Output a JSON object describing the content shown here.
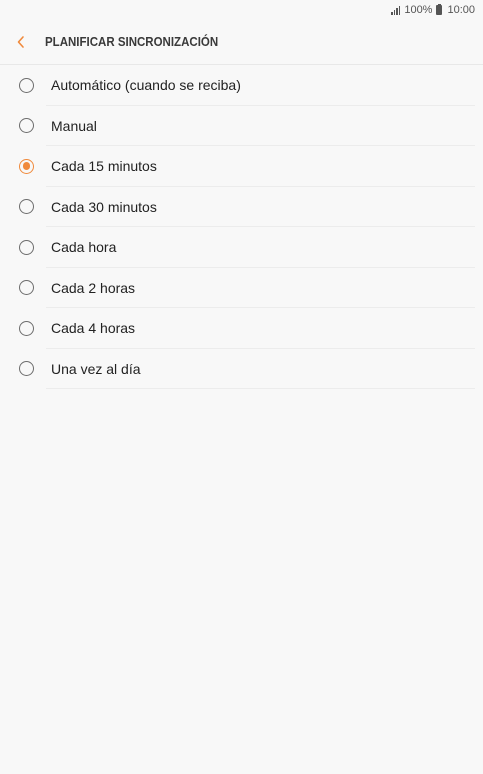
{
  "status_bar": {
    "battery": "100%",
    "time": "10:00"
  },
  "header": {
    "title": "PLANIFICAR SINCRONIZACIÓN",
    "back_icon": "chevron-left-icon"
  },
  "colors": {
    "accent": "#f08a3c",
    "background": "#f8f8f8"
  },
  "options": [
    {
      "label": "Automático (cuando se reciba)",
      "selected": false
    },
    {
      "label": "Manual",
      "selected": false
    },
    {
      "label": "Cada 15 minutos",
      "selected": true
    },
    {
      "label": "Cada 30 minutos",
      "selected": false
    },
    {
      "label": "Cada hora",
      "selected": false
    },
    {
      "label": "Cada 2 horas",
      "selected": false
    },
    {
      "label": "Cada 4 horas",
      "selected": false
    },
    {
      "label": "Una vez al día",
      "selected": false
    }
  ]
}
